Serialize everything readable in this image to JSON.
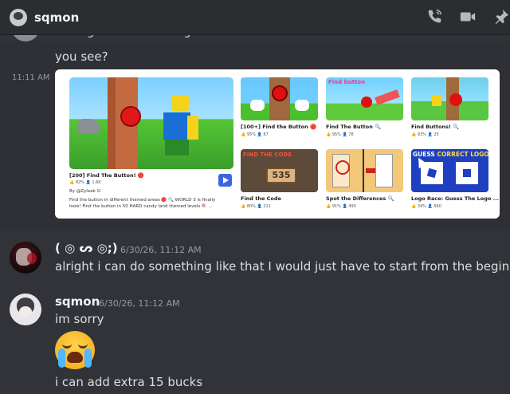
{
  "header": {
    "contact_name": "sqmon",
    "icons": [
      "phone-call-icon",
      "video-call-icon",
      "pin-icon"
    ]
  },
  "messages": {
    "cutoff_text": "i thought like something like this",
    "line_you_see": "you see?",
    "time_1111": "11:11 AM",
    "msg2": {
      "author": "( ◎ ᔕ ◎;)",
      "timestamp": "6/30/26, 11:12 AM",
      "text": "alright i can do something like that I would just have to start from the beginning"
    },
    "msg3": {
      "author": "sqmon",
      "timestamp": "6/30/26, 11:12 AM",
      "text1": "im sorry",
      "emoji": "loudly-crying-face",
      "text2": "i can add extra 15 bucks"
    }
  },
  "embed": {
    "featured": {
      "title": "[200] Find The Button! 🔴",
      "stats": "👍 82%   👤 1.6K",
      "creator": "By @Zyleak ☑",
      "desc1": "Find the button in different themed areas 🔴 🔍 WORLD 3 is finally",
      "desc2": "here! Find the button in 50 HARD candy land themed levels 🍭 ..."
    },
    "cards": [
      {
        "title": "[100+] Find the Button 🔴",
        "stats": "👍 95%   👤 87"
      },
      {
        "title": "Find The Button 🔍",
        "stats": "👍 95%   👤 78"
      },
      {
        "title": "Find Buttons! 🔍",
        "stats": "👍 93%   👤 25"
      },
      {
        "title": "Find the Code",
        "stats": "👍 80%   👤 211"
      },
      {
        "title": "Spot the Differences 🔍",
        "stats": "👍 91%   👤 495"
      },
      {
        "title": "Logo Race: Guess The Logo ...",
        "stats": "👍 34%   👤 660"
      }
    ],
    "thumb_text": {
      "t2": "Find button",
      "t4_label": "FIND THE CODE",
      "t4_sign": "535",
      "t6_label_a": "GUESS ",
      "t6_label_b": "CORRECT LOGO"
    }
  }
}
